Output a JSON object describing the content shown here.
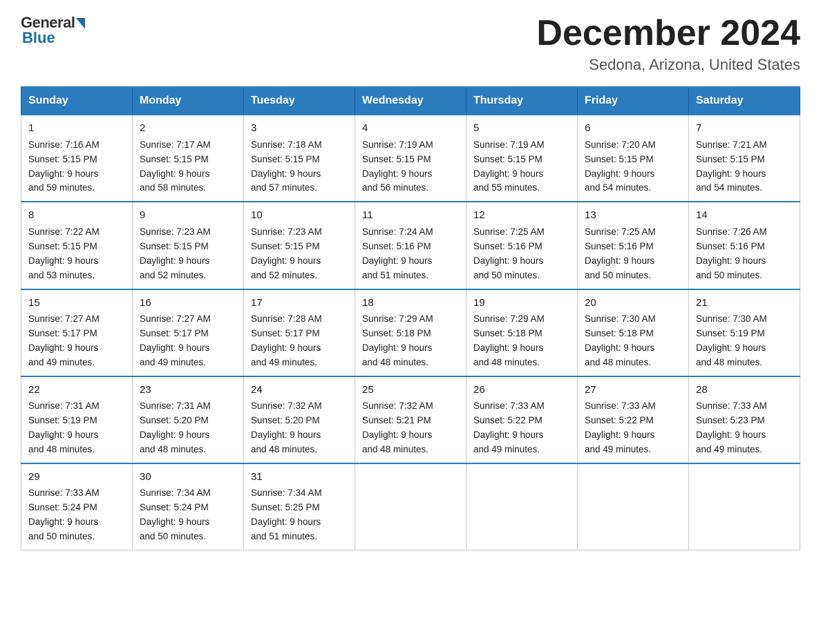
{
  "header": {
    "logo_general": "General",
    "logo_blue": "Blue",
    "month_title": "December 2024",
    "location": "Sedona, Arizona, United States"
  },
  "days_of_week": [
    "Sunday",
    "Monday",
    "Tuesday",
    "Wednesday",
    "Thursday",
    "Friday",
    "Saturday"
  ],
  "weeks": [
    [
      {
        "day": "1",
        "sunrise": "7:16 AM",
        "sunset": "5:15 PM",
        "daylight": "9 hours and 59 minutes."
      },
      {
        "day": "2",
        "sunrise": "7:17 AM",
        "sunset": "5:15 PM",
        "daylight": "9 hours and 58 minutes."
      },
      {
        "day": "3",
        "sunrise": "7:18 AM",
        "sunset": "5:15 PM",
        "daylight": "9 hours and 57 minutes."
      },
      {
        "day": "4",
        "sunrise": "7:19 AM",
        "sunset": "5:15 PM",
        "daylight": "9 hours and 56 minutes."
      },
      {
        "day": "5",
        "sunrise": "7:19 AM",
        "sunset": "5:15 PM",
        "daylight": "9 hours and 55 minutes."
      },
      {
        "day": "6",
        "sunrise": "7:20 AM",
        "sunset": "5:15 PM",
        "daylight": "9 hours and 54 minutes."
      },
      {
        "day": "7",
        "sunrise": "7:21 AM",
        "sunset": "5:15 PM",
        "daylight": "9 hours and 54 minutes."
      }
    ],
    [
      {
        "day": "8",
        "sunrise": "7:22 AM",
        "sunset": "5:15 PM",
        "daylight": "9 hours and 53 minutes."
      },
      {
        "day": "9",
        "sunrise": "7:23 AM",
        "sunset": "5:15 PM",
        "daylight": "9 hours and 52 minutes."
      },
      {
        "day": "10",
        "sunrise": "7:23 AM",
        "sunset": "5:15 PM",
        "daylight": "9 hours and 52 minutes."
      },
      {
        "day": "11",
        "sunrise": "7:24 AM",
        "sunset": "5:16 PM",
        "daylight": "9 hours and 51 minutes."
      },
      {
        "day": "12",
        "sunrise": "7:25 AM",
        "sunset": "5:16 PM",
        "daylight": "9 hours and 50 minutes."
      },
      {
        "day": "13",
        "sunrise": "7:25 AM",
        "sunset": "5:16 PM",
        "daylight": "9 hours and 50 minutes."
      },
      {
        "day": "14",
        "sunrise": "7:26 AM",
        "sunset": "5:16 PM",
        "daylight": "9 hours and 50 minutes."
      }
    ],
    [
      {
        "day": "15",
        "sunrise": "7:27 AM",
        "sunset": "5:17 PM",
        "daylight": "9 hours and 49 minutes."
      },
      {
        "day": "16",
        "sunrise": "7:27 AM",
        "sunset": "5:17 PM",
        "daylight": "9 hours and 49 minutes."
      },
      {
        "day": "17",
        "sunrise": "7:28 AM",
        "sunset": "5:17 PM",
        "daylight": "9 hours and 49 minutes."
      },
      {
        "day": "18",
        "sunrise": "7:29 AM",
        "sunset": "5:18 PM",
        "daylight": "9 hours and 48 minutes."
      },
      {
        "day": "19",
        "sunrise": "7:29 AM",
        "sunset": "5:18 PM",
        "daylight": "9 hours and 48 minutes."
      },
      {
        "day": "20",
        "sunrise": "7:30 AM",
        "sunset": "5:18 PM",
        "daylight": "9 hours and 48 minutes."
      },
      {
        "day": "21",
        "sunrise": "7:30 AM",
        "sunset": "5:19 PM",
        "daylight": "9 hours and 48 minutes."
      }
    ],
    [
      {
        "day": "22",
        "sunrise": "7:31 AM",
        "sunset": "5:19 PM",
        "daylight": "9 hours and 48 minutes."
      },
      {
        "day": "23",
        "sunrise": "7:31 AM",
        "sunset": "5:20 PM",
        "daylight": "9 hours and 48 minutes."
      },
      {
        "day": "24",
        "sunrise": "7:32 AM",
        "sunset": "5:20 PM",
        "daylight": "9 hours and 48 minutes."
      },
      {
        "day": "25",
        "sunrise": "7:32 AM",
        "sunset": "5:21 PM",
        "daylight": "9 hours and 48 minutes."
      },
      {
        "day": "26",
        "sunrise": "7:33 AM",
        "sunset": "5:22 PM",
        "daylight": "9 hours and 49 minutes."
      },
      {
        "day": "27",
        "sunrise": "7:33 AM",
        "sunset": "5:22 PM",
        "daylight": "9 hours and 49 minutes."
      },
      {
        "day": "28",
        "sunrise": "7:33 AM",
        "sunset": "5:23 PM",
        "daylight": "9 hours and 49 minutes."
      }
    ],
    [
      {
        "day": "29",
        "sunrise": "7:33 AM",
        "sunset": "5:24 PM",
        "daylight": "9 hours and 50 minutes."
      },
      {
        "day": "30",
        "sunrise": "7:34 AM",
        "sunset": "5:24 PM",
        "daylight": "9 hours and 50 minutes."
      },
      {
        "day": "31",
        "sunrise": "7:34 AM",
        "sunset": "5:25 PM",
        "daylight": "9 hours and 51 minutes."
      },
      null,
      null,
      null,
      null
    ]
  ],
  "labels": {
    "sunrise_prefix": "Sunrise: ",
    "sunset_prefix": "Sunset: ",
    "daylight_prefix": "Daylight: "
  }
}
